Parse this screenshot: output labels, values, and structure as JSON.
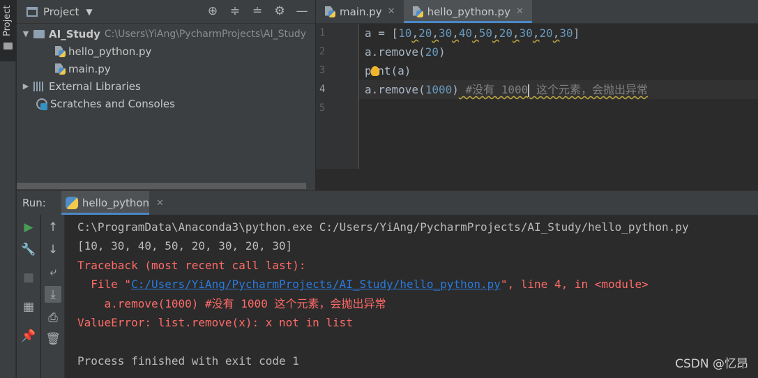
{
  "sidebar": {
    "project_tab_label": "Project"
  },
  "project_panel": {
    "title": "Project",
    "tree": {
      "root_name": "AI_Study",
      "root_path": "C:\\Users\\YiAng\\PycharmProjects\\AI_Study",
      "files": [
        "hello_python.py",
        "main.py"
      ],
      "external_libraries": "External Libraries",
      "scratches": "Scratches and Consoles"
    }
  },
  "editor": {
    "tabs": [
      {
        "label": "main.py"
      },
      {
        "label": "hello_python.py"
      }
    ],
    "line_numbers": [
      "1",
      "2",
      "3",
      "4",
      "5"
    ],
    "code": {
      "line1_prefix": "a = [",
      "line1_values": [
        "10",
        "20",
        "30",
        "40",
        "50",
        "20",
        "30",
        "20",
        "30"
      ],
      "line1_suffix": "]",
      "line2_prefix": "a.remove(",
      "line2_arg": "20",
      "line2_suffix": ")",
      "line3_a": "p",
      "line3_b": "int(a)",
      "line4_prefix": "a.remove(",
      "line4_arg": "1000",
      "line4_suffix": ")",
      "line4_comment_a": " #没有 1000",
      "line4_comment_b": " 这个元素，会抛出异常"
    }
  },
  "run": {
    "label": "Run:",
    "tab_label": "hello_python",
    "console": {
      "command": "C:\\ProgramData\\Anaconda3\\python.exe C:/Users/YiAng/PycharmProjects/AI_Study/hello_python.py",
      "output": "[10, 30, 40, 50, 20, 30, 20, 30]",
      "traceback": "Traceback (most recent call last):",
      "file_prefix": "  File \"",
      "file_link": "C:/Users/YiAng/PycharmProjects/AI_Study/hello_python.py",
      "file_suffix": "\", line 4, in <module>",
      "code_line": "    a.remove(1000) #没有 1000 这个元素，会抛出异常",
      "error": "ValueError: list.remove(x): x not in list",
      "blank": "",
      "exit": "Process finished with exit code 1"
    }
  },
  "watermark": "CSDN @忆昂"
}
